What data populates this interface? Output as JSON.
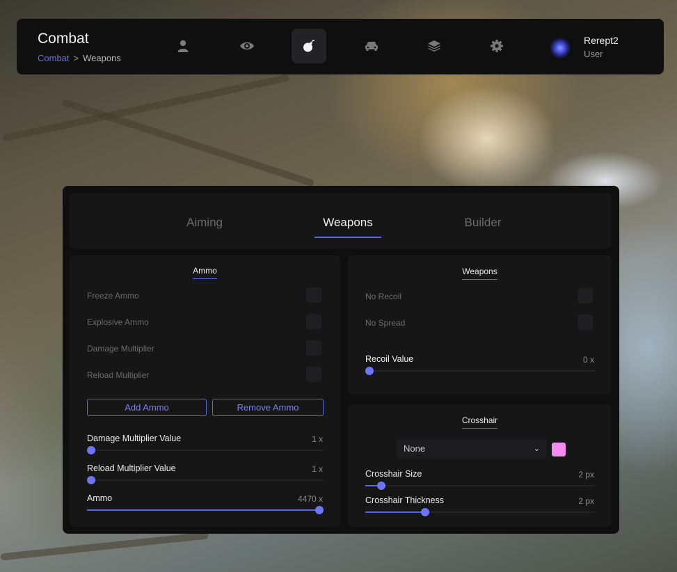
{
  "header": {
    "title": "Combat",
    "breadcrumb": {
      "root": "Combat",
      "separator": ">",
      "current": "Weapons"
    },
    "nav_icons": [
      "user-icon",
      "eye-icon",
      "bomb-icon",
      "car-icon",
      "layers-icon",
      "gear-icon"
    ],
    "active_nav": "bomb-icon",
    "user": {
      "name": "Rerept2",
      "role": "User"
    }
  },
  "tabs": [
    {
      "label": "Aiming",
      "active": false
    },
    {
      "label": "Weapons",
      "active": true
    },
    {
      "label": "Builder",
      "active": false
    }
  ],
  "ammo_card": {
    "title": "Ammo",
    "options": [
      {
        "label": "Freeze Ammo",
        "checked": false
      },
      {
        "label": "Explosive Ammo",
        "checked": false
      },
      {
        "label": "Damage Multiplier",
        "checked": false
      },
      {
        "label": "Reload Multiplier",
        "checked": false
      }
    ],
    "add_button": "Add Ammo",
    "remove_button": "Remove Ammo",
    "sliders": [
      {
        "label": "Damage Multiplier Value",
        "value_text": "1 x",
        "fraction": 0.0
      },
      {
        "label": "Reload Multiplier Value",
        "value_text": "1 x",
        "fraction": 0.0
      },
      {
        "label": "Ammo",
        "value_text": "4470 x",
        "fraction": 1.0
      }
    ]
  },
  "weapons_card": {
    "title": "Weapons",
    "options": [
      {
        "label": "No Recoil",
        "checked": false
      },
      {
        "label": "No Spread",
        "checked": false
      }
    ],
    "slider": {
      "label": "Recoil Value",
      "value_text": "0 x",
      "fraction": 0.0
    }
  },
  "crosshair_card": {
    "title": "Crosshair",
    "select_value": "None",
    "color": "#f48cf0",
    "sliders": [
      {
        "label": "Crosshair Size",
        "value_text": "2 px",
        "fraction": 0.07
      },
      {
        "label": "Crosshair Thickness",
        "value_text": "2 px",
        "fraction": 0.26
      }
    ]
  },
  "colors": {
    "accent": "#5a66e0",
    "panel": "#0f0f10",
    "card": "#161617"
  }
}
